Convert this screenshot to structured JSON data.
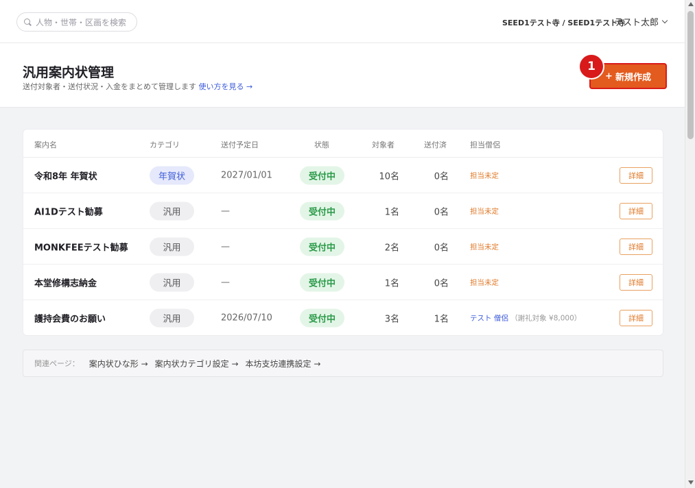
{
  "search": {
    "placeholder": "人物・世帯・区画を検索",
    "icon": "search-icon"
  },
  "topbar": {
    "temple": "SEED1テスト寺 / SEED1テスト寺",
    "user": "テスト太郎",
    "user_chevron_icon": "chevron-down-icon"
  },
  "header": {
    "title": "汎用案内状管理",
    "subtitle": "送付対象者・送付状況・入金をまとめて管理します",
    "help_link": "使い方を見る →",
    "new_button": {
      "icon": "+",
      "label": "新規作成"
    },
    "annotation_badge": "1"
  },
  "table": {
    "columns": [
      "案内名",
      "カテゴリ",
      "送付予定日",
      "状態",
      "対象者",
      "送付済",
      "担当僧侶"
    ],
    "rows": [
      {
        "name": "令和8年 年賀状",
        "category": "年賀状",
        "category_type": "nenga",
        "date": "2027/01/01",
        "status": "受付中",
        "targets": "10名",
        "sent": "0名",
        "monk": "担当未定",
        "monk_note": "",
        "detail": "詳細"
      },
      {
        "name": "AI1Dテスト勧募",
        "category": "汎用",
        "category_type": "hanyo",
        "date": "—",
        "status": "受付中",
        "targets": "1名",
        "sent": "0名",
        "monk": "担当未定",
        "monk_note": "",
        "detail": "詳細"
      },
      {
        "name": "MONKFEEテスト勧募",
        "category": "汎用",
        "category_type": "hanyo",
        "date": "—",
        "status": "受付中",
        "targets": "2名",
        "sent": "0名",
        "monk": "担当未定",
        "monk_note": "",
        "detail": "詳細"
      },
      {
        "name": "本堂修構志納金",
        "category": "汎用",
        "category_type": "hanyo",
        "date": "—",
        "status": "受付中",
        "targets": "1名",
        "sent": "0名",
        "monk": "担当未定",
        "monk_note": "",
        "detail": "詳細"
      },
      {
        "name": "護持会費のお願い",
        "category": "汎用",
        "category_type": "hanyo",
        "date": "2026/07/10",
        "status": "受付中",
        "targets": "3名",
        "sent": "1名",
        "monk": "テスト 僧侶",
        "monk_note": "（謝礼対象 ¥8,000）",
        "detail": "詳細"
      }
    ]
  },
  "related": {
    "label": "関連ページ：",
    "links": [
      "案内状ひな形 →",
      "案内状カテゴリ設定 →",
      "本坊支坊連携設定 →"
    ]
  },
  "colors": {
    "accent": "#e35b1e",
    "link": "#3d5bd9",
    "status_green": "#2a9a48",
    "unassigned": "#e07a2a"
  }
}
